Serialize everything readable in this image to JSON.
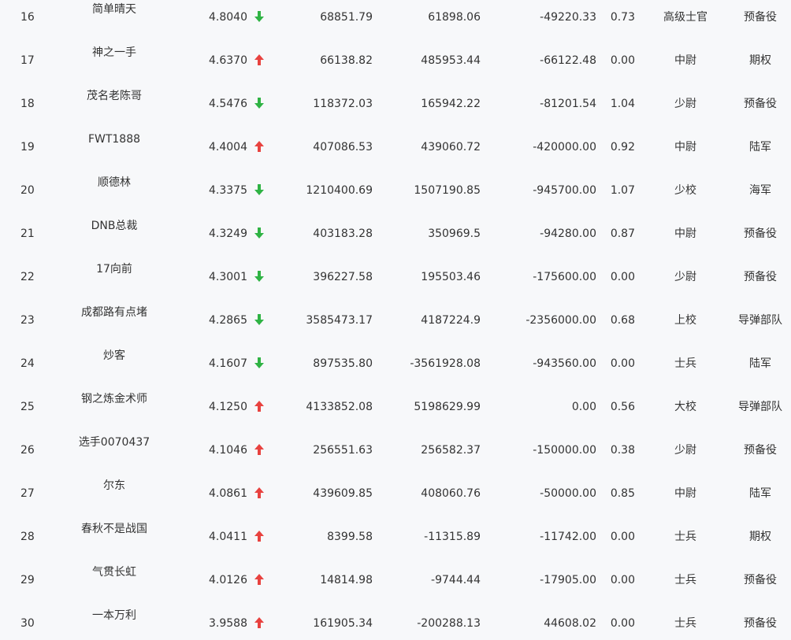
{
  "rows": [
    {
      "rank": "16",
      "name": "简单晴天",
      "score": "4.8040",
      "trend": "down",
      "col1": "68851.79",
      "col2": "61898.06",
      "col3": "-49220.33",
      "ratio": "0.73",
      "military_rank": "高级士官",
      "corps": "预备役"
    },
    {
      "rank": "17",
      "name": "神之一手",
      "score": "4.6370",
      "trend": "up",
      "col1": "66138.82",
      "col2": "485953.44",
      "col3": "-66122.48",
      "ratio": "0.00",
      "military_rank": "中尉",
      "corps": "期权"
    },
    {
      "rank": "18",
      "name": "茂名老陈哥",
      "score": "4.5476",
      "trend": "down",
      "col1": "118372.03",
      "col2": "165942.22",
      "col3": "-81201.54",
      "ratio": "1.04",
      "military_rank": "少尉",
      "corps": "预备役"
    },
    {
      "rank": "19",
      "name": "FWT1888",
      "score": "4.4004",
      "trend": "up",
      "col1": "407086.53",
      "col2": "439060.72",
      "col3": "-420000.00",
      "ratio": "0.92",
      "military_rank": "中尉",
      "corps": "陆军"
    },
    {
      "rank": "20",
      "name": "顺德林",
      "score": "4.3375",
      "trend": "down",
      "col1": "1210400.69",
      "col2": "1507190.85",
      "col3": "-945700.00",
      "ratio": "1.07",
      "military_rank": "少校",
      "corps": "海军"
    },
    {
      "rank": "21",
      "name": "DNB总裁",
      "score": "4.3249",
      "trend": "down",
      "col1": "403183.28",
      "col2": "350969.5",
      "col3": "-94280.00",
      "ratio": "0.87",
      "military_rank": "中尉",
      "corps": "预备役"
    },
    {
      "rank": "22",
      "name": "17向前",
      "score": "4.3001",
      "trend": "down",
      "col1": "396227.58",
      "col2": "195503.46",
      "col3": "-175600.00",
      "ratio": "0.00",
      "military_rank": "少尉",
      "corps": "预备役"
    },
    {
      "rank": "23",
      "name": "成都路有点堵",
      "score": "4.2865",
      "trend": "down",
      "col1": "3585473.17",
      "col2": "4187224.9",
      "col3": "-2356000.00",
      "ratio": "0.68",
      "military_rank": "上校",
      "corps": "导弹部队"
    },
    {
      "rank": "24",
      "name": "炒客",
      "score": "4.1607",
      "trend": "down",
      "col1": "897535.80",
      "col2": "-3561928.08",
      "col3": "-943560.00",
      "ratio": "0.00",
      "military_rank": "士兵",
      "corps": "陆军"
    },
    {
      "rank": "25",
      "name": "钢之炼金术师",
      "score": "4.1250",
      "trend": "up",
      "col1": "4133852.08",
      "col2": "5198629.99",
      "col3": "0.00",
      "ratio": "0.56",
      "military_rank": "大校",
      "corps": "导弹部队"
    },
    {
      "rank": "26",
      "name": "选手0070437",
      "score": "4.1046",
      "trend": "up",
      "col1": "256551.63",
      "col2": "256582.37",
      "col3": "-150000.00",
      "ratio": "0.38",
      "military_rank": "少尉",
      "corps": "预备役"
    },
    {
      "rank": "27",
      "name": "尔东",
      "score": "4.0861",
      "trend": "up",
      "col1": "439609.85",
      "col2": "408060.76",
      "col3": "-50000.00",
      "ratio": "0.85",
      "military_rank": "中尉",
      "corps": "陆军"
    },
    {
      "rank": "28",
      "name": "春秋不是战国",
      "score": "4.0411",
      "trend": "up",
      "col1": "8399.58",
      "col2": "-11315.89",
      "col3": "-11742.00",
      "ratio": "0.00",
      "military_rank": "士兵",
      "corps": "期权"
    },
    {
      "rank": "29",
      "name": "气贯长虹",
      "score": "4.0126",
      "trend": "up",
      "col1": "14814.98",
      "col2": "-9744.44",
      "col3": "-17905.00",
      "ratio": "0.00",
      "military_rank": "士兵",
      "corps": "预备役"
    },
    {
      "rank": "30",
      "name": "一本万利",
      "score": "3.9588",
      "trend": "up",
      "col1": "161905.34",
      "col2": "-200288.13",
      "col3": "44608.02",
      "ratio": "0.00",
      "military_rank": "士兵",
      "corps": "预备役"
    }
  ],
  "colors": {
    "up": "#e8423f",
    "down": "#2fb344",
    "text": "#333333",
    "background": "#f7f8fa"
  },
  "icons": {
    "up": "arrow-up-icon",
    "down": "arrow-down-icon"
  }
}
